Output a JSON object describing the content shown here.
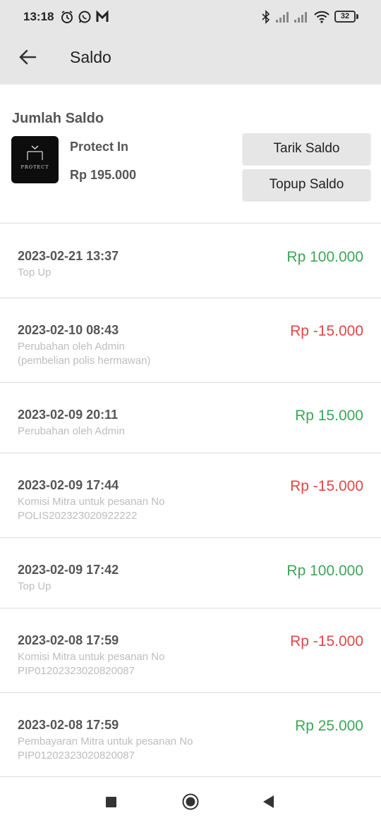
{
  "status_bar": {
    "time": "13:18",
    "battery": "32",
    "icons": [
      "alarm-icon",
      "whatsapp-icon",
      "m-app-icon",
      "bluetooth-icon",
      "signal-icon",
      "signal-icon",
      "wifi-icon",
      "battery-icon"
    ]
  },
  "app_bar": {
    "title": "Saldo",
    "back_icon": "arrow-left-icon"
  },
  "balance": {
    "heading": "Jumlah Saldo",
    "merchant_name": "Protect In",
    "amount": "Rp 195.000",
    "logo_text": "PROTECT",
    "withdraw_label": "Tarik Saldo",
    "topup_label": "Topup Saldo"
  },
  "colors": {
    "positive": "#3aa757",
    "negative": "#e04646",
    "header_bg": "#e6e6e6"
  },
  "transactions": [
    {
      "date": "2023-02-21 13:37",
      "description": "Top Up",
      "amount": "Rp 100.000",
      "type": "positive"
    },
    {
      "date": "2023-02-10 08:43",
      "description": "Perubahan oleh Admin\n(pembelian polis hermawan)",
      "amount": "Rp -15.000",
      "type": "negative"
    },
    {
      "date": "2023-02-09 20:11",
      "description": "Perubahan oleh Admin",
      "amount": "Rp 15.000",
      "type": "positive"
    },
    {
      "date": "2023-02-09 17:44",
      "description": "Komisi Mitra untuk pesanan No\nPOLIS202323020922222",
      "amount": "Rp -15.000",
      "type": "negative"
    },
    {
      "date": "2023-02-09 17:42",
      "description": "Top Up",
      "amount": "Rp 100.000",
      "type": "positive"
    },
    {
      "date": "2023-02-08 17:59",
      "description": "Komisi Mitra untuk pesanan No\nPIP01202323020820087",
      "amount": "Rp -15.000",
      "type": "negative"
    },
    {
      "date": "2023-02-08 17:59",
      "description": "Pembayaran Mitra untuk pesanan No\nPIP01202323020820087",
      "amount": "Rp 25.000",
      "type": "positive"
    }
  ],
  "nav_bar": {
    "icons": [
      "recents-square-icon",
      "home-circle-icon",
      "back-triangle-icon"
    ]
  }
}
